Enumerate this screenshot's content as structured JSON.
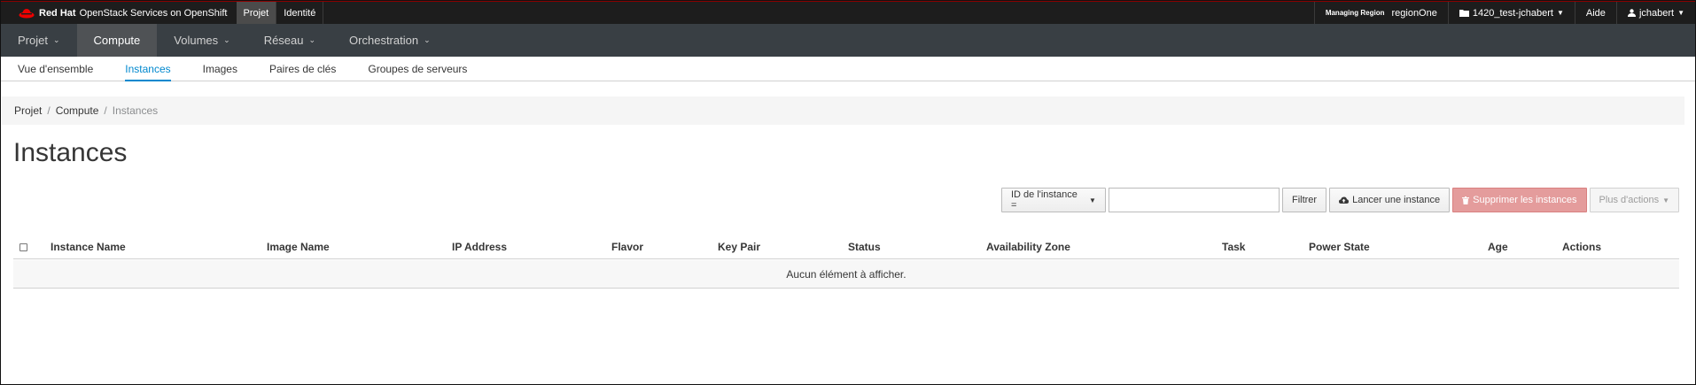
{
  "topbar": {
    "brand_name": "Red Hat",
    "brand_product": "OpenStack Services on OpenShift",
    "tabs": [
      {
        "label": "Projet"
      },
      {
        "label": "Identité"
      }
    ],
    "region_label": "Managing Region",
    "region_value": "regionOne",
    "project_selector": "1420_test-jchabert",
    "help_label": "Aide",
    "user_label": "jchabert"
  },
  "mainnav": {
    "items": [
      {
        "label": "Projet"
      },
      {
        "label": "Compute"
      },
      {
        "label": "Volumes"
      },
      {
        "label": "Réseau"
      },
      {
        "label": "Orchestration"
      }
    ]
  },
  "subnav": {
    "items": [
      {
        "label": "Vue d'ensemble"
      },
      {
        "label": "Instances"
      },
      {
        "label": "Images"
      },
      {
        "label": "Paires de clés"
      },
      {
        "label": "Groupes de serveurs"
      }
    ]
  },
  "breadcrumb": {
    "items": [
      "Projet",
      "Compute",
      "Instances"
    ]
  },
  "page": {
    "title": "Instances"
  },
  "actions": {
    "filter_field": "ID de l'instance =",
    "search_value": "",
    "filter_button": "Filtrer",
    "launch_button": "Lancer une instance",
    "delete_button": "Supprimer les instances",
    "more_button": "Plus d'actions"
  },
  "table": {
    "columns": [
      "Instance Name",
      "Image Name",
      "IP Address",
      "Flavor",
      "Key Pair",
      "Status",
      "Availability Zone",
      "Task",
      "Power State",
      "Age",
      "Actions"
    ],
    "empty_message": "Aucun élément à afficher."
  },
  "colors": {
    "accent": "#0088ce",
    "danger": "#e49c9c",
    "nav_bg": "#393f44",
    "topbar_bg": "#1d1d1d"
  }
}
